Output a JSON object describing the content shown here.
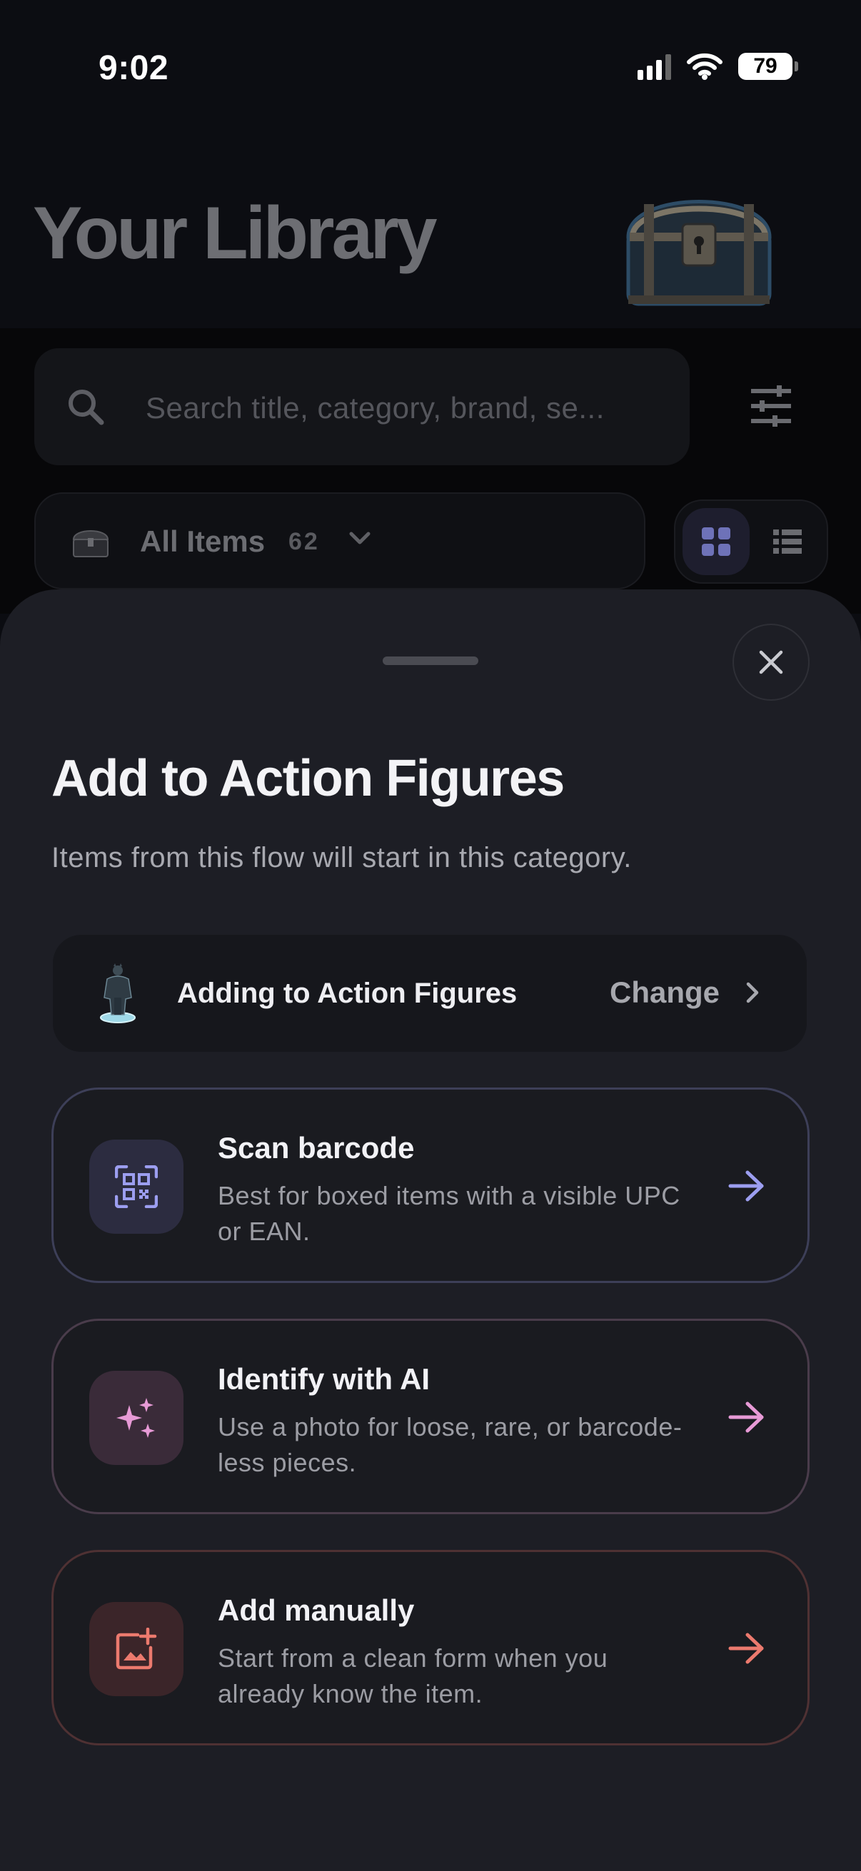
{
  "status_bar": {
    "time": "9:02",
    "battery": "79",
    "icons": [
      "signal-icon",
      "wifi-icon",
      "battery-icon"
    ]
  },
  "header": {
    "title": "Your Library",
    "logo_icon": "treasure-chest-icon"
  },
  "search": {
    "placeholder": "Search title, category, brand, se..."
  },
  "filter_bar": {
    "category_label": "All Items",
    "category_count": "62",
    "views": [
      "grid-view",
      "list-view"
    ],
    "selected_view": "grid-view"
  },
  "sheet": {
    "title": "Add to Action Figures",
    "subtitle": "Items from this flow will start in this category.",
    "target": {
      "label": "Adding to Action Figures",
      "change_label": "Change"
    },
    "options": [
      {
        "title": "Scan barcode",
        "description": "Best for boxed items with a visible UPC or EAN.",
        "icon": "barcode-scan-icon",
        "accent": "#9c9ef0"
      },
      {
        "title": "Identify with AI",
        "description": "Use a photo for loose, rare, or barcode-less pieces.",
        "icon": "sparkles-icon",
        "accent": "#e79ad6"
      },
      {
        "title": "Add manually",
        "description": "Start from a clean form when you already know the item.",
        "icon": "add-photo-icon",
        "accent": "#ec7a6e"
      }
    ]
  },
  "colors": {
    "sheet_background": "#1d1e25",
    "screen_background": "#0b0c11"
  }
}
